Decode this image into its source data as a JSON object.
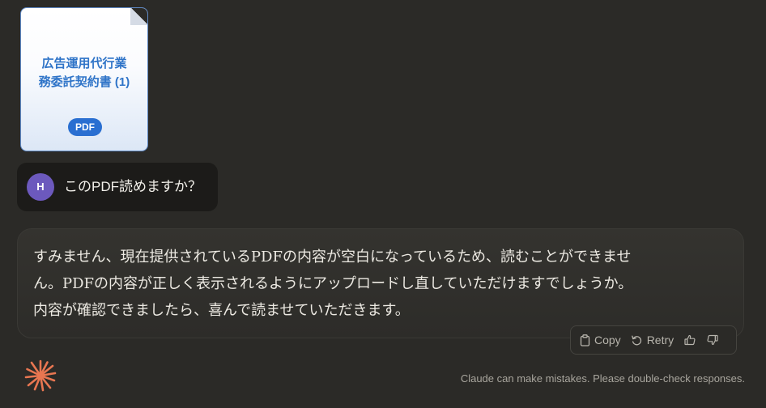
{
  "attachment": {
    "title": "広告運用代行業\n務委託契約書 (1)",
    "badge": "PDF"
  },
  "user_message": {
    "avatar_initial": "H",
    "text": "このPDF読めますか？"
  },
  "assistant_message": {
    "lines": [
      "すみません、現在提供されているPDFの内容が空白になっているため、読むことができませ",
      "ん。PDFの内容が正しく表示されるようにアップロードし直していただけますでしょうか。",
      "内容が確認できましたら、喜んで読ませていただきます。"
    ]
  },
  "actions": {
    "copy_label": "Copy",
    "retry_label": "Retry"
  },
  "footer": {
    "disclaimer": "Claude can make mistakes. Please double-check responses."
  },
  "colors": {
    "background": "#2b2a27",
    "user_bubble": "#1c1b19",
    "avatar": "#6c59bd",
    "pdf_badge": "#2a6fd1",
    "pdf_title": "#2f74c8",
    "claude_accent": "#e87651"
  },
  "icons": {
    "copy": "clipboard-icon",
    "retry": "retry-arrow-icon",
    "thumbs_up": "thumbs-up-icon",
    "thumbs_down": "thumbs-down-icon",
    "logo": "claude-starburst-icon"
  }
}
